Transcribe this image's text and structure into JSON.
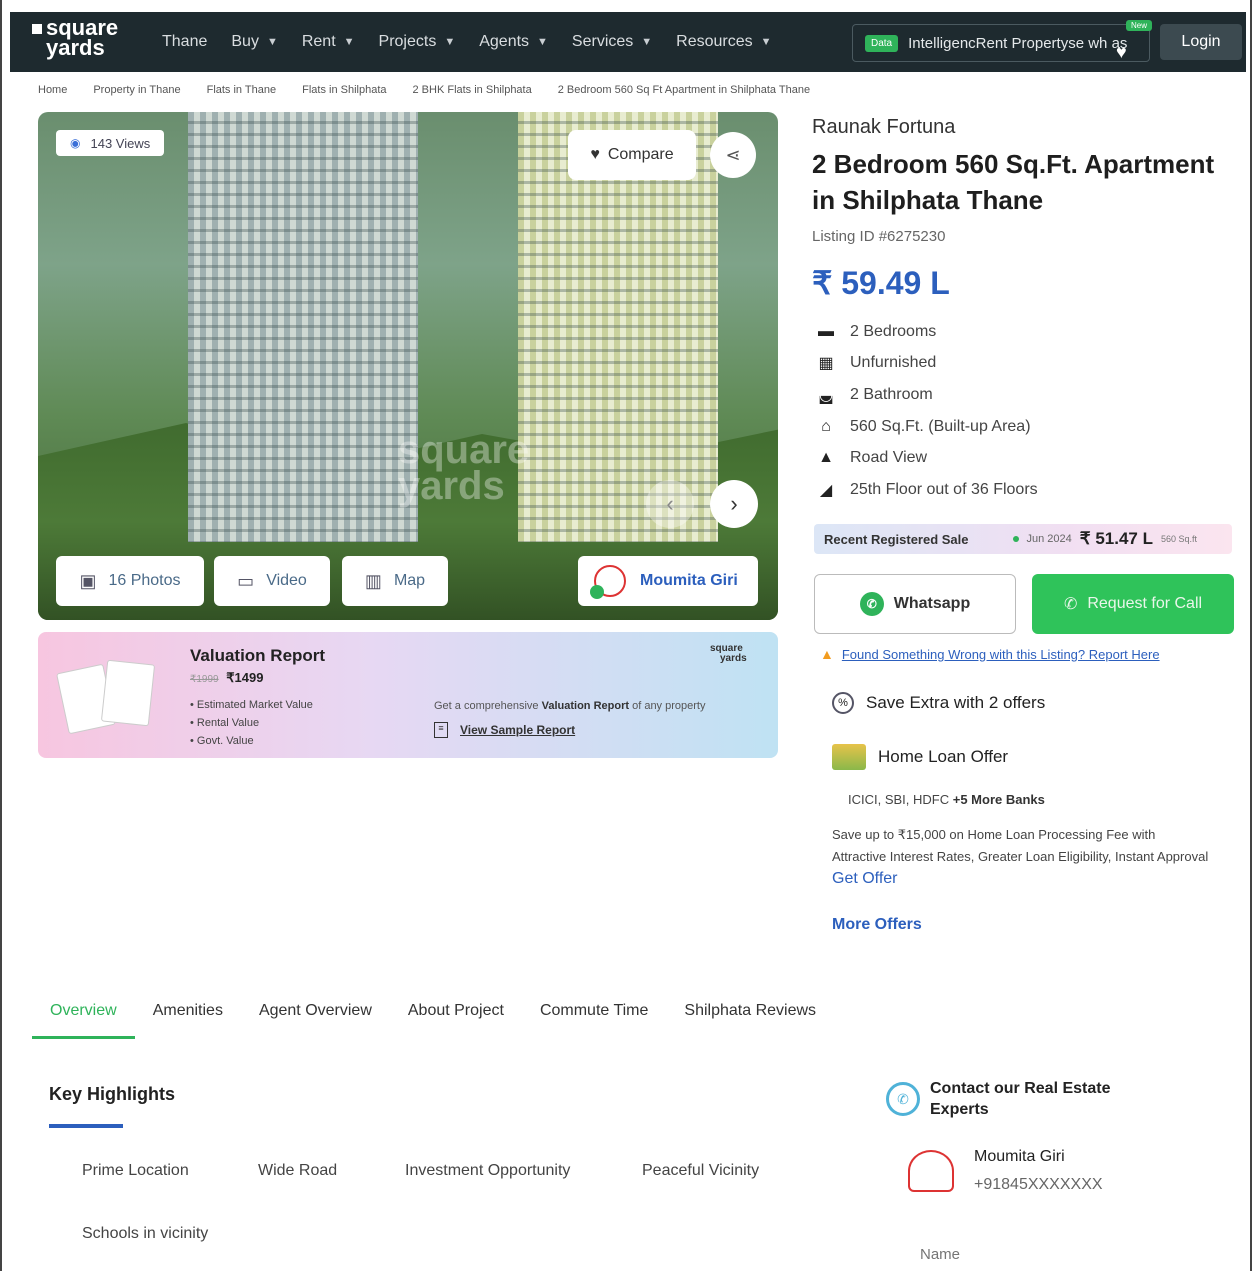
{
  "header": {
    "logo_top": "square",
    "logo_bottom": "yards",
    "nav": [
      "Thane",
      "Buy",
      "Rent",
      "Projects",
      "Agents",
      "Services",
      "Resources"
    ],
    "data_badge": "Data",
    "promo_text": "IntelligencRent Propertyse wh as",
    "new_badge": "New",
    "login": "Login"
  },
  "breadcrumb": [
    "Home",
    "Property in Thane",
    "Flats in Thane",
    "Flats in Shilphata",
    "2 BHK Flats in Shilphata",
    "2 Bedroom 560 Sq Ft Apartment in Shilphata Thane"
  ],
  "gallery": {
    "views": "143 Views",
    "compare": "Compare",
    "watermark_top": "square",
    "watermark_bottom": "yards",
    "photos": "16 Photos",
    "video": "Video",
    "map": "Map",
    "agent": "Moumita Giri"
  },
  "valuation": {
    "title": "Valuation Report",
    "old_price": "₹1999",
    "new_price": "₹1499",
    "points": [
      "Estimated Market Value",
      "Rental Value",
      "Govt. Value"
    ],
    "desc_pre": "Get a comprehensive",
    "desc_bold": "Valuation Report",
    "desc_post": "of any property",
    "link": "View Sample Report",
    "logo_top": "square",
    "logo_bottom": "yards"
  },
  "listing": {
    "project": "Raunak Fortuna",
    "title": "2 Bedroom 560 Sq.Ft. Apartment in Shilphata Thane",
    "listing_id": "Listing ID #6275230",
    "price": "₹ 59.49 L",
    "features": [
      {
        "icon": "bed-icon",
        "text": "2 Bedrooms"
      },
      {
        "icon": "sofa-icon",
        "text": "Unfurnished"
      },
      {
        "icon": "bathtub-icon",
        "text": "2 Bathroom"
      },
      {
        "icon": "house-icon",
        "text": "560 Sq.Ft. (Built-up Area)"
      },
      {
        "icon": "road-view-icon",
        "text": "Road View"
      },
      {
        "icon": "floor-icon",
        "text": "25th Floor out of 36 Floors"
      }
    ],
    "recent_label": "Recent Registered Sale",
    "recent_date": "Jun 2024",
    "recent_amount": "₹ 51.47 L",
    "recent_area": "560 Sq.ft",
    "whatsapp": "Whatsapp",
    "request_call": "Request for Call",
    "report": "Found Something Wrong with this Listing? Report Here",
    "save_extra": "Save Extra with 2 offers",
    "home_loan": "Home Loan Offer",
    "banks_plain": "ICICI, SBI, HDFC",
    "banks_more": "+5 More Banks",
    "loan_desc": "Save up to ₹15,000 on Home Loan Processing Fee with Attractive Interest Rates, Greater Loan Eligibility, Instant Approval",
    "get_offer": "Get Offer",
    "more_offers": "More Offers"
  },
  "tabs": [
    "Overview",
    "Amenities",
    "Agent Overview",
    "About Project",
    "Commute Time",
    "Shilphata Reviews"
  ],
  "key_highlights": {
    "title": "Key Highlights",
    "items": [
      "Prime Location",
      "Wide Road",
      "Investment Opportunity",
      "Peaceful Vicinity",
      "Schools in vicinity"
    ]
  },
  "contact": {
    "title": "Contact our Real Estate Experts",
    "name": "Moumita Giri",
    "phone": "+91845XXXXXXX",
    "name_placeholder": "Name"
  },
  "colors": {
    "header_bg": "#1e2a2f",
    "brand_blue": "#2c5fbd",
    "brand_green": "#2fb35a"
  }
}
